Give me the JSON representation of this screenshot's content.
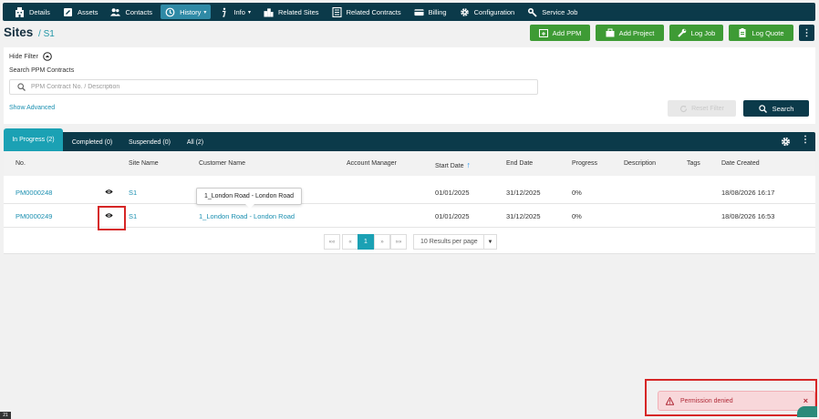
{
  "nav": {
    "items": [
      {
        "label": "Details",
        "icon": "building-icon"
      },
      {
        "label": "Assets",
        "icon": "asset-icon"
      },
      {
        "label": "Contacts",
        "icon": "contacts-icon"
      },
      {
        "label": "History",
        "icon": "history-icon",
        "active": true
      },
      {
        "label": "Info",
        "icon": "info-icon"
      },
      {
        "label": "Related Sites",
        "icon": "sites-icon"
      },
      {
        "label": "Related Contracts",
        "icon": "contracts-icon"
      },
      {
        "label": "Billing",
        "icon": "billing-icon"
      },
      {
        "label": "Configuration",
        "icon": "gear-icon"
      },
      {
        "label": "Service Job",
        "icon": "service-icon"
      }
    ]
  },
  "header": {
    "title": "Sites",
    "separator": "/",
    "crumb": "S1",
    "buttons": {
      "add_ppm": "Add PPM",
      "add_project": "Add Project",
      "log_job": "Log Job",
      "log_quote": "Log Quote",
      "more": "⋮"
    }
  },
  "filter": {
    "hide_label": "Hide Filter",
    "search_label": "Search PPM Contracts",
    "search_placeholder": "PPM Contract No. / Description",
    "search_value": "",
    "show_advanced": "Show Advanced",
    "reset_label": "Reset Filter",
    "search_button": "Search"
  },
  "tabs": [
    {
      "label": "In Progress (2)",
      "active": true
    },
    {
      "label": "Completed (0)"
    },
    {
      "label": "Suspended (0)"
    },
    {
      "label": "All (2)"
    }
  ],
  "table": {
    "columns": [
      "No.",
      "Site Name",
      "Customer Name",
      "Account Manager",
      "Start Date",
      "End Date",
      "Progress",
      "Description",
      "Tags",
      "Date Created"
    ],
    "rows": [
      {
        "no": "PM0000248",
        "site": "S1",
        "customer": "",
        "manager": "",
        "start": "01/01/2025",
        "end": "31/12/2025",
        "progress": "0%",
        "description": "",
        "tags": "",
        "created": "18/08/2026 16:17"
      },
      {
        "no": "PM0000249",
        "site": "S1",
        "customer": "1_London Road - London Road",
        "manager": "",
        "start": "01/01/2025",
        "end": "31/12/2025",
        "progress": "0%",
        "description": "",
        "tags": "",
        "created": "18/08/2026 16:53"
      }
    ],
    "tooltip": "1_London Road - London Road"
  },
  "pagination": {
    "first": "««",
    "prev": "«",
    "current": "1",
    "next": "»",
    "last": "»»",
    "per_page": "10 Results per page"
  },
  "toast": {
    "message": "Permission denied",
    "close": "×"
  },
  "corner_badge": "21",
  "colors": {
    "nav_bg": "#0b3a4a",
    "accent": "#1ba1b4",
    "green": "#3e9b35",
    "link": "#1a8fb0",
    "error": "#d62626"
  }
}
